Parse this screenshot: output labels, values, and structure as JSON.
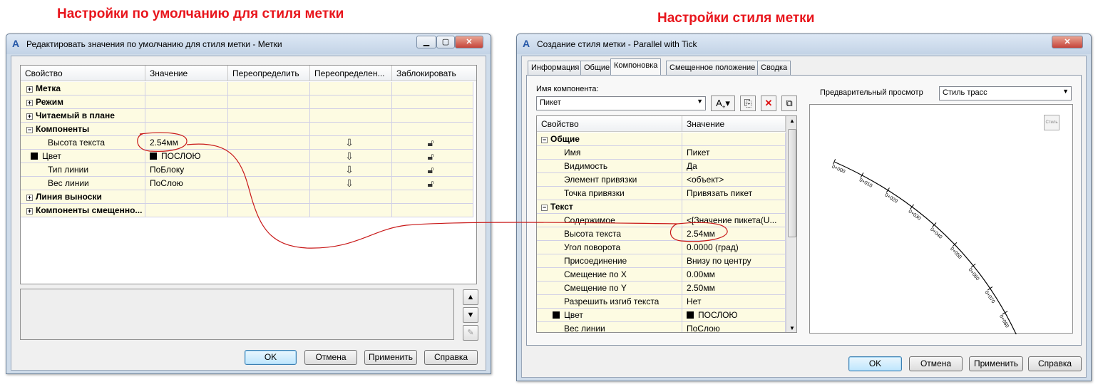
{
  "headings": {
    "left": "Настройки по умолчанию для стиля метки",
    "right": "Настройки стиля метки"
  },
  "left_window": {
    "title": "Редактировать значения по умолчанию для стиля метки - Метки",
    "columns": [
      "Свойство",
      "Значение",
      "Переопределить",
      "Переопределен...",
      "Заблокировать"
    ],
    "rows": [
      {
        "label": "Метка",
        "value": ""
      },
      {
        "label": "Режим",
        "value": ""
      },
      {
        "label": "Читаемый в плане",
        "value": ""
      },
      {
        "label": "Компоненты",
        "value": ""
      },
      {
        "label": "Высота текста",
        "value": "2.54мм"
      },
      {
        "label": "Цвет",
        "value": "ПОСЛОЮ"
      },
      {
        "label": "Тип линии",
        "value": "ПоБлоку"
      },
      {
        "label": "Вес линии",
        "value": "ПоСлою"
      },
      {
        "label": "Линия выноски",
        "value": ""
      },
      {
        "label": "Компоненты смещенно...",
        "value": ""
      }
    ],
    "buttons": {
      "ok": "OK",
      "cancel": "Отмена",
      "apply": "Применить",
      "help": "Справка"
    }
  },
  "right_window": {
    "title": "Создание стиля метки - Parallel with Tick",
    "tabs": [
      "Информация",
      "Общие",
      "Компоновка",
      "Смещенное положение",
      "Сводка"
    ],
    "active_tab": "Компоновка",
    "component_name_label": "Имя компонента:",
    "component_value": "Пикет",
    "columns": [
      "Свойство",
      "Значение"
    ],
    "rows": [
      {
        "label": "Общие",
        "value": ""
      },
      {
        "label": "Имя",
        "value": "Пикет"
      },
      {
        "label": "Видимость",
        "value": "Да"
      },
      {
        "label": "Элемент привязки",
        "value": "<объект>"
      },
      {
        "label": "Точка привязки",
        "value": "Привязать пикет"
      },
      {
        "label": "Текст",
        "value": ""
      },
      {
        "label": "Содержимое",
        "value": "<[Значение пикета(U..."
      },
      {
        "label": "Высота текста",
        "value": "2.54мм"
      },
      {
        "label": "Угол поворота",
        "value": "0.0000 (град)"
      },
      {
        "label": "Присоединение",
        "value": "Внизу по центру"
      },
      {
        "label": "Смещение по X",
        "value": "0.00мм"
      },
      {
        "label": "Смещение по Y",
        "value": "2.50мм"
      },
      {
        "label": "Разрешить изгиб текста",
        "value": "Нет"
      },
      {
        "label": "Цвет",
        "value": "ПОСЛОЮ"
      },
      {
        "label": "Вес линии",
        "value": "ПоСлою"
      }
    ],
    "preview_label": "Предварительный просмотр",
    "preview_style": "Стиль трасс",
    "preview_thumb": "Стиль",
    "station_labels": [
      "0+000",
      "0+010",
      "0+020",
      "0+030",
      "0+040",
      "0+050",
      "0+060",
      "0+070",
      "0+080",
      "0+090"
    ],
    "buttons": {
      "ok": "OK",
      "cancel": "Отмена",
      "apply": "Применить",
      "help": "Справка"
    }
  },
  "colors": {
    "heading": "#e8151c",
    "annotation": "#c81818",
    "grid_fill": "#fdfbe2"
  }
}
